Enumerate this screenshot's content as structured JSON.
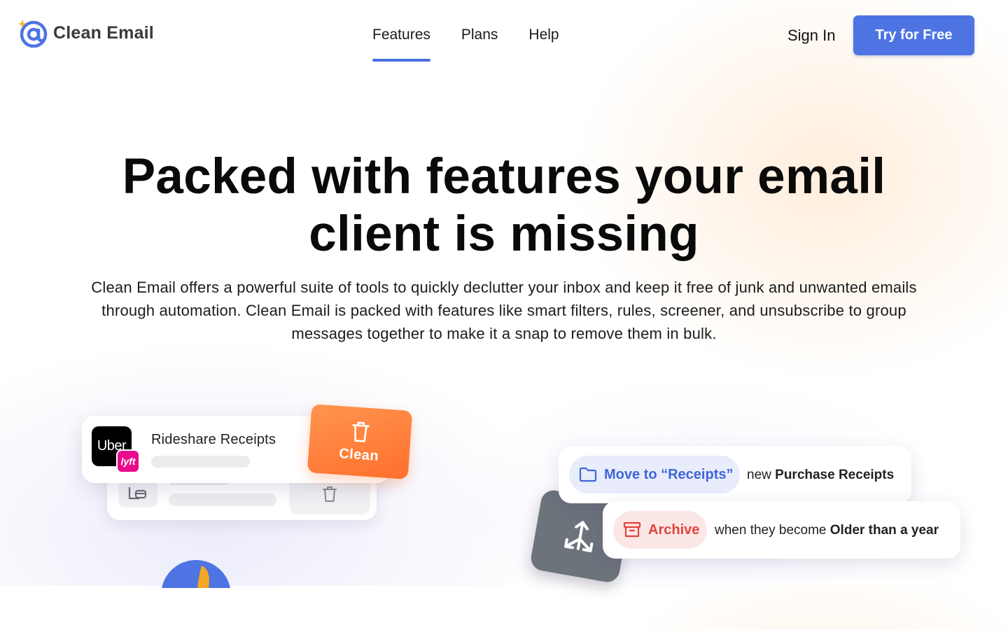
{
  "header": {
    "logo_text": "Clean Email",
    "nav": [
      {
        "label": "Features",
        "active": true
      },
      {
        "label": "Plans",
        "active": false
      },
      {
        "label": "Help",
        "active": false
      }
    ],
    "sign_in": "Sign In",
    "cta": "Try for Free"
  },
  "hero": {
    "title_line1": "Packed with features your email",
    "title_line2": "client is missing",
    "subtitle_line1": "Clean Email offers a powerful suite of tools to quickly declutter your inbox and keep it free of junk and unwanted emails",
    "subtitle_line2": "through automation. Clean Email is packed with features like smart filters, rules, screener, and unsubscribe to group",
    "subtitle_line3": "messages together to make it a snap to remove them in bulk."
  },
  "illustration": {
    "group_card": {
      "title": "Rideshare Receipts",
      "logo_primary": "Uber",
      "logo_secondary": "lyft",
      "action_label": "Clean"
    },
    "rule_move": {
      "action_label": "Move to “Receipts”",
      "prefix": "new",
      "target": "Purchase Receipts"
    },
    "rule_archive": {
      "action_label": "Archive",
      "prefix": "when they become",
      "target": "Older than a year"
    }
  },
  "colors": {
    "accent": "#4e74e4",
    "clean_orange": "#ff7a35",
    "archive_red": "#e0453d",
    "move_blue": "#3e66d8",
    "lyft_pink": "#ea0b8c"
  },
  "icons": [
    "at-sign-logo-icon",
    "sparkle-icon",
    "trash-icon",
    "folder-icon",
    "archive-box-icon",
    "move-arrows-icon",
    "receipt-icon"
  ]
}
